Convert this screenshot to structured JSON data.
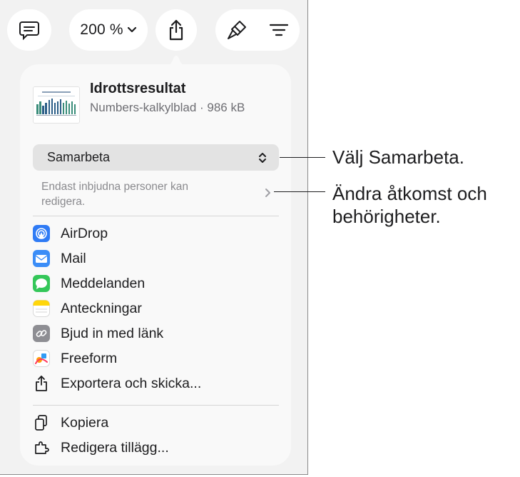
{
  "toolbar": {
    "zoom_label": "200 %"
  },
  "document": {
    "title": "Idrottsresultat",
    "subtitle": "Numbers-kalkylblad · 986 kB"
  },
  "collaboration": {
    "selected": "Samarbeta",
    "access_text_line1": "Endast inbjudna personer kan",
    "access_text_line2": "redigera."
  },
  "share_items": [
    {
      "label": "AirDrop",
      "icon": "airdrop-icon"
    },
    {
      "label": "Mail",
      "icon": "mail-icon"
    },
    {
      "label": "Meddelanden",
      "icon": "messages-icon"
    },
    {
      "label": "Anteckningar",
      "icon": "notes-icon"
    },
    {
      "label": "Bjud in med länk",
      "icon": "link-icon"
    },
    {
      "label": "Freeform",
      "icon": "freeform-icon"
    },
    {
      "label": "Exportera och skicka...",
      "icon": "export-icon"
    }
  ],
  "actions": [
    {
      "label": "Kopiera",
      "icon": "copy-icon"
    },
    {
      "label": "Redigera tillägg...",
      "icon": "extensions-icon"
    }
  ],
  "callouts": {
    "choose_collaborate": "Välj Samarbeta.",
    "change_access_line1": "Ändra åtkomst och",
    "change_access_line2": "behörigheter."
  },
  "colors": {
    "accent": "#2f7bf5",
    "messages": "#34c759",
    "notes": "#ffd60a",
    "link": "#8e8e93"
  }
}
